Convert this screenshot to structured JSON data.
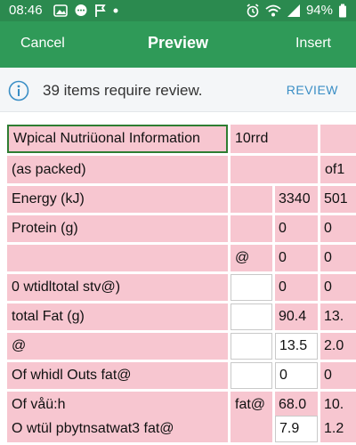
{
  "status": {
    "time": "08:46",
    "battery": "94%"
  },
  "header": {
    "cancel": "Cancel",
    "title": "Preview",
    "insert": "Insert"
  },
  "banner": {
    "message": "39 items require review.",
    "action": "REVIEW"
  },
  "table": {
    "rows": [
      [
        "Wpical Nutriüonal Information",
        "10rrd",
        "",
        ""
      ],
      [
        "(as packed)",
        "",
        "",
        "of1"
      ],
      [
        "Energy (kJ)",
        "",
        "3340",
        "501"
      ],
      [
        "Protein (g)",
        "",
        "0",
        "0"
      ],
      [
        "",
        "@",
        "0",
        "0"
      ],
      [
        "0 wtidltotal stv@)",
        "",
        "0",
        "0"
      ],
      [
        "total Fat (g)",
        "",
        "90.4",
        "13."
      ],
      [
        "@",
        "",
        "13.5",
        "2.0"
      ],
      [
        "Of whidl Outs fat@",
        "",
        "0",
        "0"
      ],
      [
        "Of våü:h",
        "fat@",
        "68.0",
        "10."
      ],
      [
        "O wtül pbytnsatwat3 fat@",
        "",
        "7.9",
        "1.2"
      ]
    ]
  }
}
